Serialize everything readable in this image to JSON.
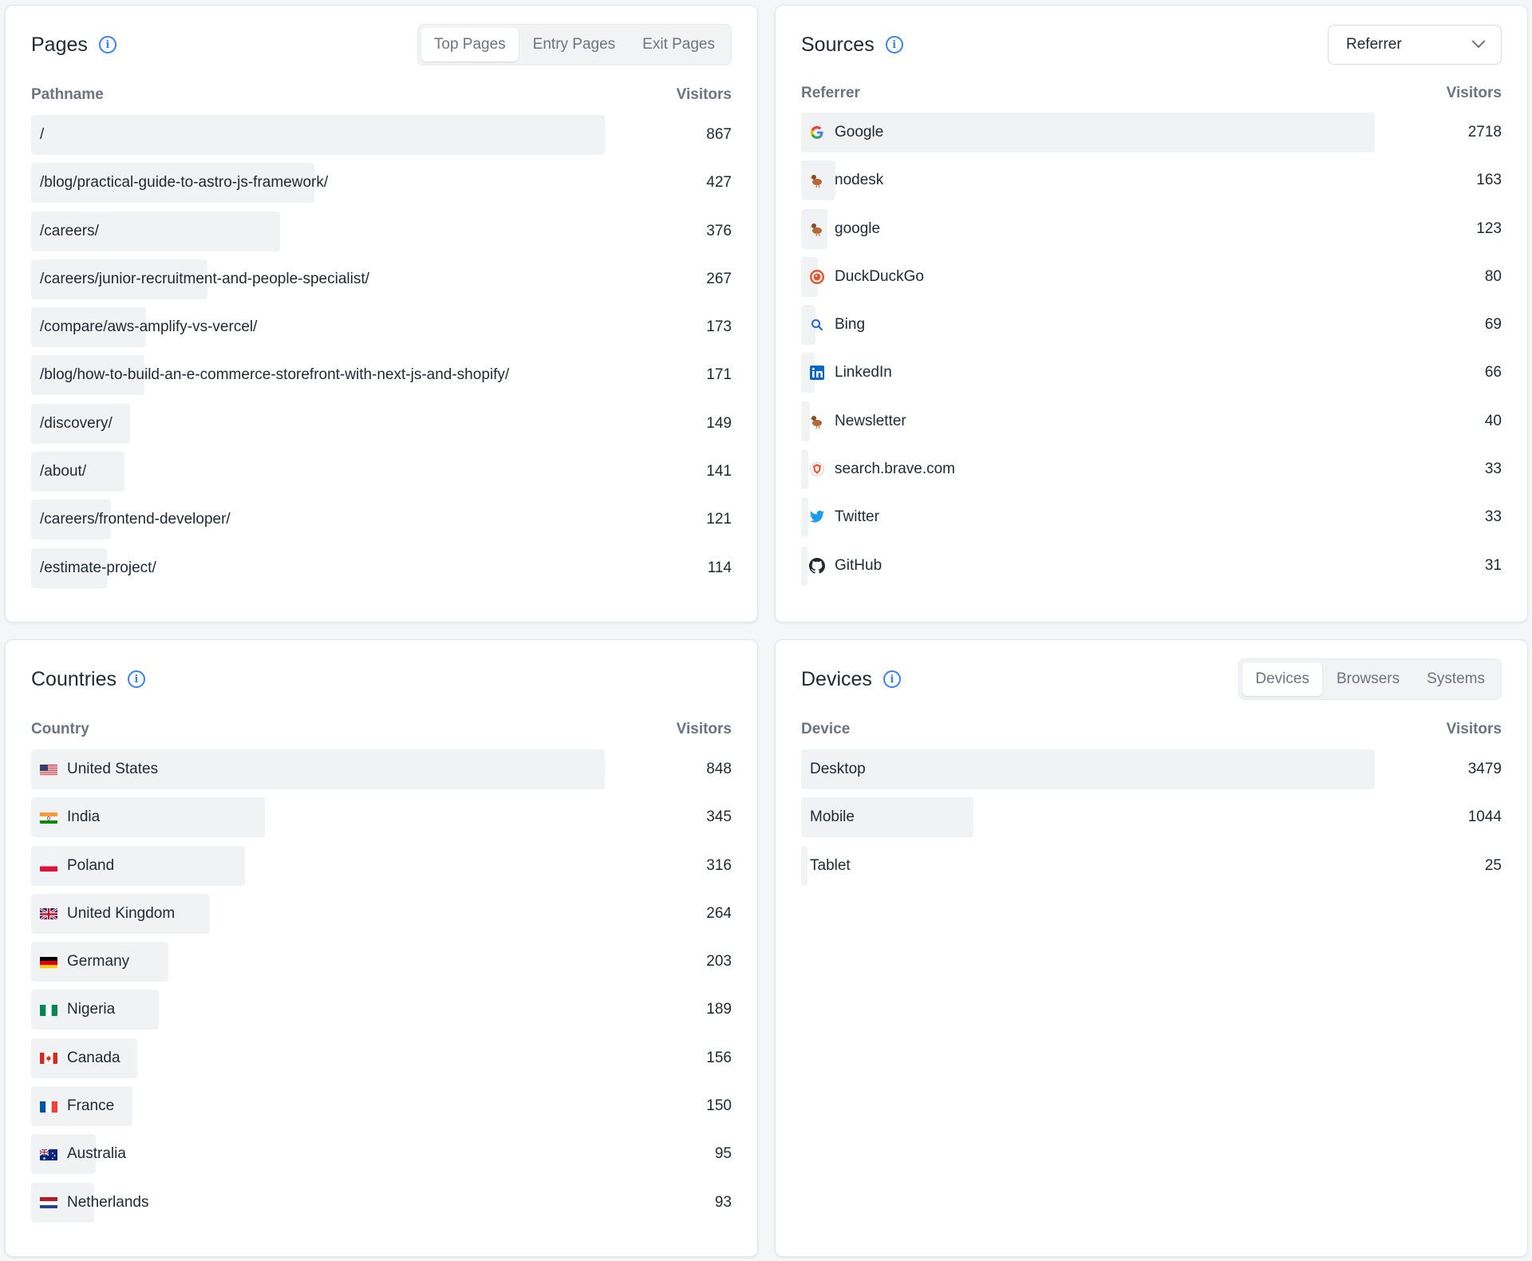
{
  "pages": {
    "title": "Pages",
    "tabs": [
      "Top Pages",
      "Entry Pages",
      "Exit Pages"
    ],
    "active_tab": 0,
    "col_label": "Pathname",
    "col_value": "Visitors",
    "rows": [
      {
        "label": "/",
        "value": "867",
        "fraction": 0.79
      },
      {
        "label": "/blog/practical-guide-to-astro-js-framework/",
        "value": "427",
        "fraction": 0.39
      },
      {
        "label": "/careers/",
        "value": "376",
        "fraction": 0.343
      },
      {
        "label": "/careers/junior-recruitment-and-people-specialist/",
        "value": "267",
        "fraction": 0.243
      },
      {
        "label": "/compare/aws-amplify-vs-vercel/",
        "value": "173",
        "fraction": 0.158
      },
      {
        "label": "/blog/how-to-build-an-e-commerce-storefront-with-next-js-and-shopify/",
        "value": "171",
        "fraction": 0.156
      },
      {
        "label": "/discovery/",
        "value": "149",
        "fraction": 0.136
      },
      {
        "label": "/about/",
        "value": "141",
        "fraction": 0.129
      },
      {
        "label": "/careers/frontend-developer/",
        "value": "121",
        "fraction": 0.11
      },
      {
        "label": "/estimate-project/",
        "value": "114",
        "fraction": 0.104
      }
    ]
  },
  "sources": {
    "title": "Sources",
    "dropdown_value": "Referrer",
    "col_label": "Referrer",
    "col_value": "Visitors",
    "rows": [
      {
        "label": "Google",
        "value": "2718",
        "fraction": 0.79,
        "icon": "google-icon"
      },
      {
        "label": "nodesk",
        "value": "163",
        "fraction": 0.047,
        "icon": "duck-icon"
      },
      {
        "label": "google",
        "value": "123",
        "fraction": 0.036,
        "icon": "duck-icon"
      },
      {
        "label": "DuckDuckGo",
        "value": "80",
        "fraction": 0.023,
        "icon": "duckduckgo-icon"
      },
      {
        "label": "Bing",
        "value": "69",
        "fraction": 0.02,
        "icon": "bing-icon"
      },
      {
        "label": "LinkedIn",
        "value": "66",
        "fraction": 0.019,
        "icon": "linkedin-icon"
      },
      {
        "label": "Newsletter",
        "value": "40",
        "fraction": 0.012,
        "icon": "duck-icon"
      },
      {
        "label": "search.brave.com",
        "value": "33",
        "fraction": 0.01,
        "icon": "brave-icon"
      },
      {
        "label": "Twitter",
        "value": "33",
        "fraction": 0.01,
        "icon": "twitter-icon"
      },
      {
        "label": "GitHub",
        "value": "31",
        "fraction": 0.009,
        "icon": "github-icon"
      }
    ]
  },
  "countries": {
    "title": "Countries",
    "col_label": "Country",
    "col_value": "Visitors",
    "rows": [
      {
        "label": "United States",
        "value": "848",
        "fraction": 0.79,
        "flag": "us"
      },
      {
        "label": "India",
        "value": "345",
        "fraction": 0.322,
        "flag": "in"
      },
      {
        "label": "Poland",
        "value": "316",
        "fraction": 0.295,
        "flag": "pl"
      },
      {
        "label": "United Kingdom",
        "value": "264",
        "fraction": 0.246,
        "flag": "gb"
      },
      {
        "label": "Germany",
        "value": "203",
        "fraction": 0.189,
        "flag": "de"
      },
      {
        "label": "Nigeria",
        "value": "189",
        "fraction": 0.176,
        "flag": "ng"
      },
      {
        "label": "Canada",
        "value": "156",
        "fraction": 0.146,
        "flag": "ca"
      },
      {
        "label": "France",
        "value": "150",
        "fraction": 0.14,
        "flag": "fr"
      },
      {
        "label": "Australia",
        "value": "95",
        "fraction": 0.089,
        "flag": "au"
      },
      {
        "label": "Netherlands",
        "value": "93",
        "fraction": 0.087,
        "flag": "nl"
      }
    ]
  },
  "devices": {
    "title": "Devices",
    "tabs": [
      "Devices",
      "Browsers",
      "Systems"
    ],
    "active_tab": 0,
    "col_label": "Device",
    "col_value": "Visitors",
    "rows": [
      {
        "label": "Desktop",
        "value": "3479",
        "fraction": 0.79
      },
      {
        "label": "Mobile",
        "value": "1044",
        "fraction": 0.237
      },
      {
        "label": "Tablet",
        "value": "25",
        "fraction": 0.009
      }
    ]
  },
  "colors": {
    "accent": "#3b82f6",
    "bar": "#f1f2f4",
    "muted_text": "#6b7480"
  }
}
